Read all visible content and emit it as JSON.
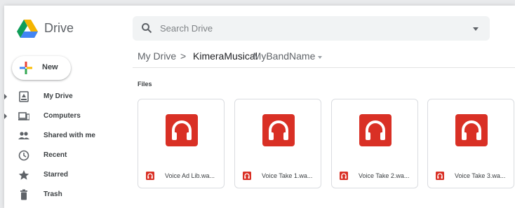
{
  "app": {
    "name": "Drive"
  },
  "search": {
    "placeholder": "Search Drive"
  },
  "sidebar": {
    "new_label": "New",
    "items": [
      {
        "label": "My Drive",
        "icon": "my-drive-icon",
        "expandable": true
      },
      {
        "label": "Computers",
        "icon": "computers-icon",
        "expandable": true
      },
      {
        "label": "Shared with me",
        "icon": "shared-icon",
        "expandable": false
      },
      {
        "label": "Recent",
        "icon": "clock-icon",
        "expandable": false
      },
      {
        "label": "Starred",
        "icon": "star-icon",
        "expandable": false
      },
      {
        "label": "Trash",
        "icon": "trash-icon",
        "expandable": false
      }
    ]
  },
  "breadcrumb": {
    "root": "My Drive",
    "separator": ">",
    "folder_main": "KimeraMusical",
    "folder_suffix": " -MyBandName"
  },
  "section": {
    "title": "Files"
  },
  "files": [
    {
      "name": "Voice Ad Lib.wa...",
      "icon": "headphones-icon"
    },
    {
      "name": "Voice Take 1.wa...",
      "icon": "headphones-icon"
    },
    {
      "name": "Voice Take 2.wa...",
      "icon": "headphones-icon"
    },
    {
      "name": "Voice Take 3.wa...",
      "icon": "headphones-icon"
    }
  ],
  "colors": {
    "audio_red": "#d93025",
    "drive_green": "#0f9d58",
    "drive_blue": "#4285f4",
    "drive_yellow": "#f4b400"
  }
}
